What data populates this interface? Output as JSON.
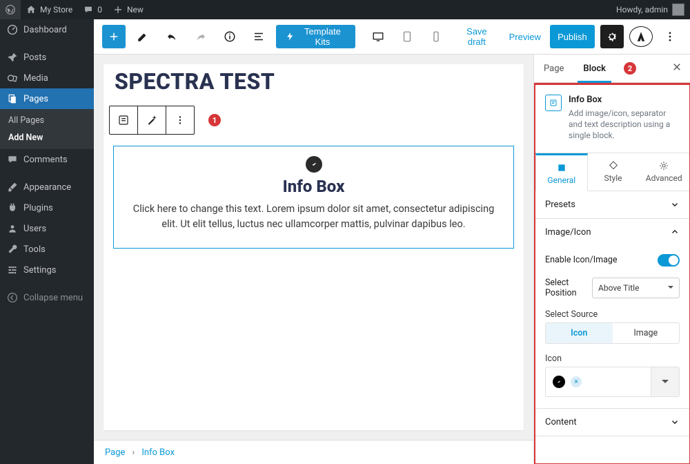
{
  "adminbar": {
    "site_name": "My Store",
    "comments": "0",
    "new_label": "New",
    "greeting": "Howdy, admin"
  },
  "sidebar": {
    "items": [
      {
        "icon": "dashboard",
        "label": "Dashboard"
      },
      {
        "icon": "pin",
        "label": "Posts"
      },
      {
        "icon": "media",
        "label": "Media"
      },
      {
        "icon": "pages",
        "label": "Pages",
        "active": true
      },
      {
        "icon": "comments",
        "label": "Comments"
      },
      {
        "icon": "brush",
        "label": "Appearance"
      },
      {
        "icon": "plug",
        "label": "Plugins"
      },
      {
        "icon": "user",
        "label": "Users"
      },
      {
        "icon": "wrench",
        "label": "Tools"
      },
      {
        "icon": "sliders",
        "label": "Settings"
      }
    ],
    "submenu": {
      "all": "All Pages",
      "add": "Add New"
    },
    "collapse": "Collapse menu"
  },
  "editor_header": {
    "template_kits": "Template Kits",
    "save_draft": "Save draft",
    "preview": "Preview",
    "publish": "Publish"
  },
  "page": {
    "title": "SPECTRA TEST"
  },
  "block": {
    "heading": "Info Box",
    "body": "Click here to change this text. Lorem ipsum dolor sit amet, consectetur adipiscing elit. Ut elit tellus, luctus nec ullamcorper mattis, pulvinar dapibus leo."
  },
  "breadcrumbs": {
    "root": "Page",
    "leaf": "Info Box"
  },
  "settings": {
    "tabs": {
      "page": "Page",
      "block": "Block"
    },
    "header": {
      "title": "Info Box",
      "desc": "Add image/icon, separator and text description using a single block."
    },
    "subtabs": {
      "general": "General",
      "style": "Style",
      "advanced": "Advanced"
    },
    "presets": "Presets",
    "image_icon": "Image/Icon",
    "enable": "Enable Icon/Image",
    "select_position": "Select Position",
    "position_value": "Above Title",
    "select_source": "Select Source",
    "source_icon": "Icon",
    "source_image": "Image",
    "icon_label": "Icon",
    "content": "Content"
  },
  "badges": {
    "one": "1",
    "two": "2"
  }
}
